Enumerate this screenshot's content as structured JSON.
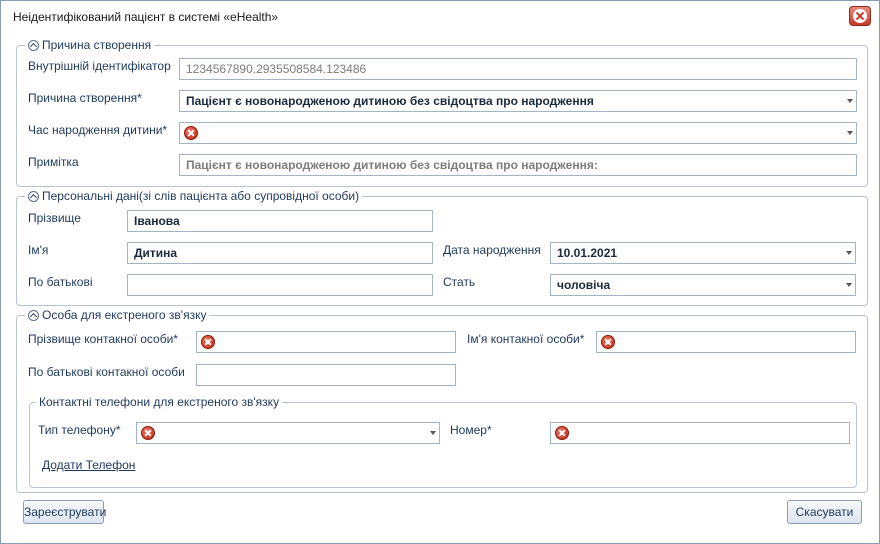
{
  "window": {
    "title": "Неідентифікований пацієнт в системі «eHealth»"
  },
  "section_reason": {
    "legend": "Причина створення",
    "internal_id": {
      "label": "Внутрішній ідентифікатор",
      "value": "1234567890.2935508584.123486"
    },
    "reason": {
      "label": "Причина створення*",
      "value": "Пацієнт є новонародженою дитиною без свідоцтва про народження"
    },
    "birth_time": {
      "label": "Час народження дитини*",
      "value": ""
    },
    "note": {
      "label": "Примітка",
      "value": "Пацієнт є новонародженою дитиною без свідоцтва про народження:"
    }
  },
  "section_personal": {
    "legend": "Персональні дані(зі слів пацієнта або супровідної особи)",
    "surname": {
      "label": "Прізвище",
      "value": "Іванова"
    },
    "name": {
      "label": "Ім'я",
      "value": "Дитина"
    },
    "patronymic": {
      "label": "По батькові",
      "value": ""
    },
    "birth_date": {
      "label": "Дата народження",
      "value": "10.01.2021"
    },
    "sex": {
      "label": "Стать",
      "value": "чоловіча"
    }
  },
  "section_contact": {
    "legend": "Особа для екстреного зв'язку",
    "contact_surname": {
      "label": "Прізвище контакної особи*",
      "value": ""
    },
    "contact_name": {
      "label": "Ім'я контакної особи*",
      "value": ""
    },
    "contact_patronymic": {
      "label": "По батькові контакної особи",
      "value": ""
    },
    "phones": {
      "legend": "Контактні телефони для екстреного зв'язку",
      "phone_type": {
        "label": "Тип телефону*",
        "value": ""
      },
      "number": {
        "label": "Номер*",
        "value": ""
      },
      "add_link": "Додати Телефон"
    }
  },
  "footer": {
    "register_label": "Зареєструвати",
    "cancel_label": "Скасувати"
  },
  "icons": {
    "close": "close-icon",
    "collapse": "chevron-up-icon",
    "error": "error-icon",
    "dropdown": "dropdown-arrow-icon"
  },
  "colors": {
    "label_text": "#1e395b",
    "border": "#b9c5d5",
    "error": "#c53a26"
  }
}
